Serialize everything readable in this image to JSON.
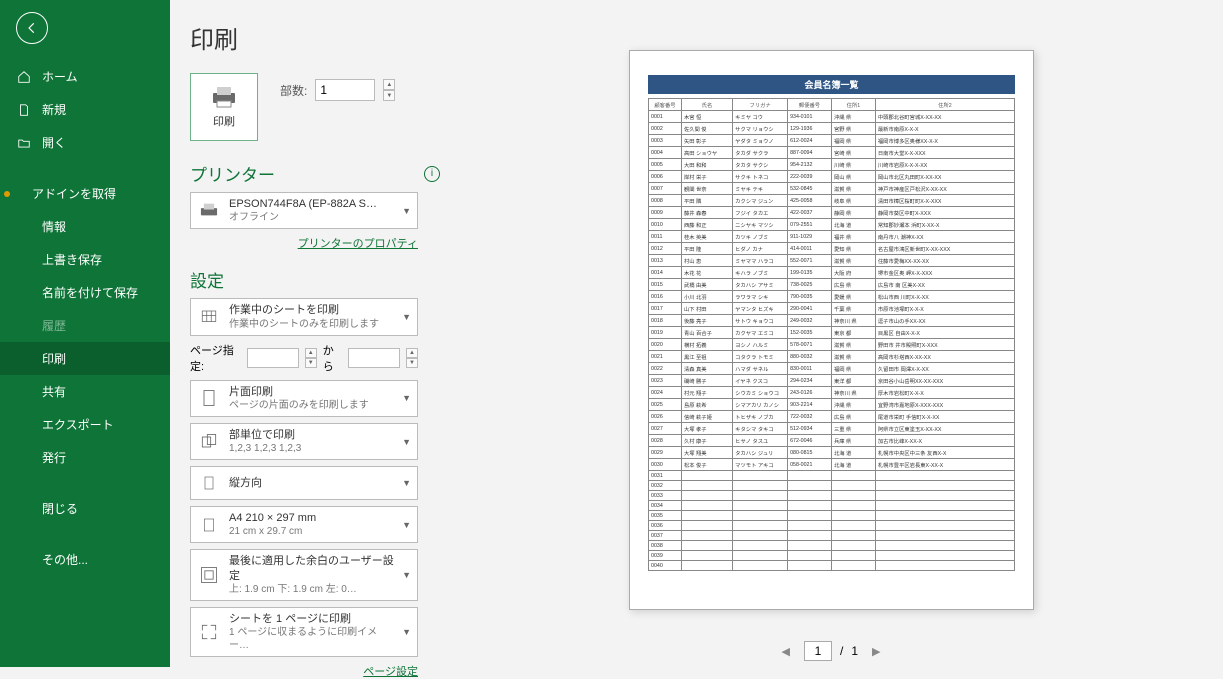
{
  "page_title": "印刷",
  "sidebar": {
    "home": "ホーム",
    "new": "新規",
    "open": "開く",
    "addin": "アドインを取得",
    "info": "情報",
    "save": "上書き保存",
    "saveas": "名前を付けて保存",
    "history": "履歴",
    "print": "印刷",
    "share": "共有",
    "export": "エクスポート",
    "publish": "発行",
    "close": "閉じる",
    "other": "その他..."
  },
  "print": {
    "button_label": "印刷",
    "copies_label": "部数:",
    "copies_value": "1"
  },
  "printer": {
    "section": "プリンター",
    "name": "EPSON744F8A (EP-882A S…",
    "status": "オフライン",
    "properties": "プリンターのプロパティ"
  },
  "settings": {
    "section": "設定",
    "what_title": "作業中のシートを印刷",
    "what_sub": "作業中のシートのみを印刷します",
    "range_label": "ページ指定:",
    "range_from": "",
    "range_to_label": "から",
    "range_to": "",
    "side_title": "片面印刷",
    "side_sub": "ページの片面のみを印刷します",
    "collate_title": "部単位で印刷",
    "collate_sub": "1,2,3     1,2,3     1,2,3",
    "orient": "縦方向",
    "paper_title": "A4 210 × 297 mm",
    "paper_sub": "21 cm x 29.7 cm",
    "margin_title": "最後に適用した余白のユーザー設定",
    "margin_sub": "上: 1.9 cm 下: 1.9 cm 左: 0…",
    "fit_title": "シートを 1 ページに印刷",
    "fit_sub": "1 ページに収まるように印刷イメー…",
    "page_setup": "ページ設定"
  },
  "pager": {
    "current": "1",
    "total": "1"
  },
  "preview": {
    "doc_title": "会員名簿一覧",
    "headers": [
      "顧客番号",
      "氏名",
      "フリガナ",
      "郵便番号",
      "住所1",
      "住所2"
    ],
    "rows": [
      [
        "0001",
        "木宮 恒",
        "キミヤ コウ",
        "934-0101",
        "沖縄 県",
        "中頭郡北谷町宮城X-XX-XX"
      ],
      [
        "0002",
        "佐久間 俊",
        "サクマ リョウシ",
        "129-1936",
        "宮野 県",
        "最新市南原X-X-X"
      ],
      [
        "0003",
        "矢田 彰子",
        "ヤダタ ミョウノ",
        "612-0024",
        "福岡 県",
        "福岡市博多区奥様XX-X-X"
      ],
      [
        "0004",
        "高田 ショウヤ",
        "タカダ サクラ",
        "887-0094",
        "宮崎 県",
        "日南市大堂X-X-XXX"
      ],
      [
        "0005",
        "大田 和和",
        "タカタ サクシ",
        "954-2132",
        "川崎 県",
        "川崎市岩原X-X-X-XX"
      ],
      [
        "0006",
        "岸村 栄子",
        "サクキ トネコ",
        "222-0039",
        "岡山 県",
        "岡山市北区丸田町X-XX-XX"
      ],
      [
        "0007",
        "観閣 世奈",
        "ミヤキ テキ",
        "532-0845",
        "滋賀 県",
        "神戸市神産区戸松沢X-XX-XX"
      ],
      [
        "0008",
        "平田 隣",
        "カクシマ ジュン",
        "425-0058",
        "岐阜 県",
        "清田市樟区桜町町X-X-XXX"
      ],
      [
        "0009",
        "藤井 森春",
        "フジイ タカエ",
        "422-0037",
        "静岡 県",
        "静岡市葵区中町X-XXX"
      ],
      [
        "0010",
        "西藤 和正",
        "ニシヤキ マツシ",
        "079-2551",
        "北海 道",
        "常知郡妙瀬本 浜町X-XX-X"
      ],
      [
        "0011",
        "桂木 英美",
        "カツキ ノブミ",
        "911-1029",
        "福井 県",
        "南丹市八 潮神X-XX"
      ],
      [
        "0012",
        "平田 隆",
        "ヒダノ カナ",
        "414-0011",
        "愛知 県",
        "名古屋市鴻区新世町X-XX-XXX"
      ],
      [
        "0013",
        "村山 恵",
        "ミヤママ ハラコ",
        "552-0071",
        "滋賀 県",
        "住藤市愛梅XX-XX-XX"
      ],
      [
        "0014",
        "木花 花",
        "キハラ ノブミ",
        "199-0135",
        "大阪 府",
        "堺市金区奥 岬X-X-XXX"
      ],
      [
        "0015",
        "武橋 由美",
        "タカハシ アサミ",
        "738-0025",
        "広島 県",
        "広島市 南 区美X-XX"
      ],
      [
        "0016",
        "小川 北羽",
        "ラワラマ シキ",
        "790-0035",
        "愛媛 県",
        "松山市西 川町X-X-XX"
      ],
      [
        "0017",
        "山下 村田",
        "ヤマンタ ヒズキ",
        "290-0041",
        "千葉 県",
        "市原市池塚町X-X-X"
      ],
      [
        "0018",
        "後藤 亮子",
        "サトウ キョウコ",
        "249-0032",
        "神奈川 県",
        "逗子市山の手XX-XX"
      ],
      [
        "0019",
        "青山 百合子",
        "カクヤマ エミコ",
        "152-0035",
        "東京 都",
        "目黒区 自由X-X-X"
      ],
      [
        "0020",
        "横村 拓義",
        "ヨシノ ハルミ",
        "578-0071",
        "滋賀 県",
        "野田市 井市殿照町X-XXX"
      ],
      [
        "0021",
        "黒江 至祖",
        "コタクラ トモミ",
        "880-0032",
        "滋賀 県",
        "高岡市杉塔西X-XX-XX"
      ],
      [
        "0022",
        "清森 真美",
        "ハマダ サネル",
        "830-0011",
        "福岡 県",
        "久留田市 岡澤X-X-XX"
      ],
      [
        "0023",
        "磯崎 勝子",
        "イヤネ クスコ",
        "294-0234",
        "東洋 都",
        "京田谷小山岳明XX-XX-XXX"
      ],
      [
        "0024",
        "村元 翔子",
        "シウカミ ショウコ",
        "243-0126",
        "神奈川 県",
        "厚木市岩松町X-X-X"
      ],
      [
        "0025",
        "島原 萩希",
        "シマアカリ カノシ",
        "903-2214",
        "沖縄 県",
        "宜野湾市嘉地原X-XXX-XXX"
      ],
      [
        "0026",
        "信崎 萩子姫",
        "トヒザキ ノブカ",
        "722-0032",
        "広島 県",
        "尾道市栄町 手信町X-X-XX"
      ],
      [
        "0027",
        "大塚 孝子",
        "キタシマ タキコ",
        "512-0934",
        "三重 県",
        "阿県市立区東塗玉X-XX-XX"
      ],
      [
        "0028",
        "久村 康子",
        "ヒサノ タスユ",
        "672-0046",
        "兵庫 県",
        "加古市比峰X-XX-X"
      ],
      [
        "0029",
        "大塚 翔美",
        "タカハシ ジュリ",
        "080-0815",
        "北海 道",
        "札幌市中央区中三条 友西X-X"
      ],
      [
        "0030",
        "松本 俊子",
        "マツモト アキコ",
        "058-0021",
        "北海 道",
        "札幌市豊平区岩長東X-XX-X"
      ],
      [
        "0031",
        "",
        "",
        "",
        "",
        ""
      ],
      [
        "0032",
        "",
        "",
        "",
        "",
        ""
      ],
      [
        "0033",
        "",
        "",
        "",
        "",
        ""
      ],
      [
        "0034",
        "",
        "",
        "",
        "",
        ""
      ],
      [
        "0035",
        "",
        "",
        "",
        "",
        ""
      ],
      [
        "0036",
        "",
        "",
        "",
        "",
        ""
      ],
      [
        "0037",
        "",
        "",
        "",
        "",
        ""
      ],
      [
        "0038",
        "",
        "",
        "",
        "",
        ""
      ],
      [
        "0039",
        "",
        "",
        "",
        "",
        ""
      ],
      [
        "0040",
        "",
        "",
        "",
        "",
        ""
      ]
    ]
  }
}
